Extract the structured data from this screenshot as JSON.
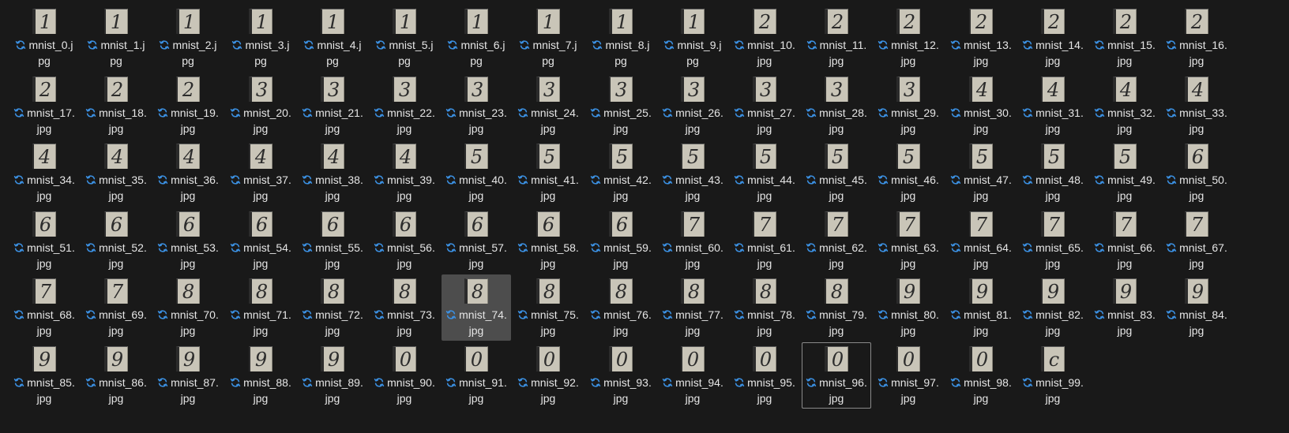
{
  "files": [
    {
      "line1": "mnist_0.j",
      "line2": "pg",
      "digit": "1"
    },
    {
      "line1": "mnist_1.j",
      "line2": "pg",
      "digit": "1"
    },
    {
      "line1": "mnist_2.j",
      "line2": "pg",
      "digit": "1"
    },
    {
      "line1": "mnist_3.j",
      "line2": "pg",
      "digit": "1"
    },
    {
      "line1": "mnist_4.j",
      "line2": "pg",
      "digit": "1"
    },
    {
      "line1": "mnist_5.j",
      "line2": "pg",
      "digit": "1"
    },
    {
      "line1": "mnist_6.j",
      "line2": "pg",
      "digit": "1"
    },
    {
      "line1": "mnist_7.j",
      "line2": "pg",
      "digit": "1"
    },
    {
      "line1": "mnist_8.j",
      "line2": "pg",
      "digit": "1"
    },
    {
      "line1": "mnist_9.j",
      "line2": "pg",
      "digit": "1"
    },
    {
      "line1": "mnist_10.",
      "line2": "jpg",
      "digit": "2"
    },
    {
      "line1": "mnist_11.",
      "line2": "jpg",
      "digit": "2"
    },
    {
      "line1": "mnist_12.",
      "line2": "jpg",
      "digit": "2"
    },
    {
      "line1": "mnist_13.",
      "line2": "jpg",
      "digit": "2"
    },
    {
      "line1": "mnist_14.",
      "line2": "jpg",
      "digit": "2"
    },
    {
      "line1": "mnist_15.",
      "line2": "jpg",
      "digit": "2"
    },
    {
      "line1": "mnist_16.",
      "line2": "jpg",
      "digit": "2"
    },
    {
      "line1": "mnist_17.",
      "line2": "jpg",
      "digit": "2"
    },
    {
      "line1": "mnist_18.",
      "line2": "jpg",
      "digit": "2"
    },
    {
      "line1": "mnist_19.",
      "line2": "jpg",
      "digit": "2"
    },
    {
      "line1": "mnist_20.",
      "line2": "jpg",
      "digit": "3"
    },
    {
      "line1": "mnist_21.",
      "line2": "jpg",
      "digit": "3"
    },
    {
      "line1": "mnist_22.",
      "line2": "jpg",
      "digit": "3"
    },
    {
      "line1": "mnist_23.",
      "line2": "jpg",
      "digit": "3"
    },
    {
      "line1": "mnist_24.",
      "line2": "jpg",
      "digit": "3"
    },
    {
      "line1": "mnist_25.",
      "line2": "jpg",
      "digit": "3"
    },
    {
      "line1": "mnist_26.",
      "line2": "jpg",
      "digit": "3"
    },
    {
      "line1": "mnist_27.",
      "line2": "jpg",
      "digit": "3"
    },
    {
      "line1": "mnist_28.",
      "line2": "jpg",
      "digit": "3"
    },
    {
      "line1": "mnist_29.",
      "line2": "jpg",
      "digit": "3"
    },
    {
      "line1": "mnist_30.",
      "line2": "jpg",
      "digit": "4"
    },
    {
      "line1": "mnist_31.",
      "line2": "jpg",
      "digit": "4"
    },
    {
      "line1": "mnist_32.",
      "line2": "jpg",
      "digit": "4"
    },
    {
      "line1": "mnist_33.",
      "line2": "jpg",
      "digit": "4"
    },
    {
      "line1": "mnist_34.",
      "line2": "jpg",
      "digit": "4"
    },
    {
      "line1": "mnist_35.",
      "line2": "jpg",
      "digit": "4"
    },
    {
      "line1": "mnist_36.",
      "line2": "jpg",
      "digit": "4"
    },
    {
      "line1": "mnist_37.",
      "line2": "jpg",
      "digit": "4"
    },
    {
      "line1": "mnist_38.",
      "line2": "jpg",
      "digit": "4"
    },
    {
      "line1": "mnist_39.",
      "line2": "jpg",
      "digit": "4"
    },
    {
      "line1": "mnist_40.",
      "line2": "jpg",
      "digit": "5"
    },
    {
      "line1": "mnist_41.",
      "line2": "jpg",
      "digit": "5"
    },
    {
      "line1": "mnist_42.",
      "line2": "jpg",
      "digit": "5"
    },
    {
      "line1": "mnist_43.",
      "line2": "jpg",
      "digit": "5"
    },
    {
      "line1": "mnist_44.",
      "line2": "jpg",
      "digit": "5"
    },
    {
      "line1": "mnist_45.",
      "line2": "jpg",
      "digit": "5"
    },
    {
      "line1": "mnist_46.",
      "line2": "jpg",
      "digit": "5"
    },
    {
      "line1": "mnist_47.",
      "line2": "jpg",
      "digit": "5"
    },
    {
      "line1": "mnist_48.",
      "line2": "jpg",
      "digit": "5"
    },
    {
      "line1": "mnist_49.",
      "line2": "jpg",
      "digit": "5"
    },
    {
      "line1": "mnist_50.",
      "line2": "jpg",
      "digit": "6"
    },
    {
      "line1": "mnist_51.",
      "line2": "jpg",
      "digit": "6"
    },
    {
      "line1": "mnist_52.",
      "line2": "jpg",
      "digit": "6"
    },
    {
      "line1": "mnist_53.",
      "line2": "jpg",
      "digit": "6"
    },
    {
      "line1": "mnist_54.",
      "line2": "jpg",
      "digit": "6"
    },
    {
      "line1": "mnist_55.",
      "line2": "jpg",
      "digit": "6"
    },
    {
      "line1": "mnist_56.",
      "line2": "jpg",
      "digit": "6"
    },
    {
      "line1": "mnist_57.",
      "line2": "jpg",
      "digit": "6"
    },
    {
      "line1": "mnist_58.",
      "line2": "jpg",
      "digit": "6"
    },
    {
      "line1": "mnist_59.",
      "line2": "jpg",
      "digit": "6"
    },
    {
      "line1": "mnist_60.",
      "line2": "jpg",
      "digit": "7"
    },
    {
      "line1": "mnist_61.",
      "line2": "jpg",
      "digit": "7"
    },
    {
      "line1": "mnist_62.",
      "line2": "jpg",
      "digit": "7"
    },
    {
      "line1": "mnist_63.",
      "line2": "jpg",
      "digit": "7"
    },
    {
      "line1": "mnist_64.",
      "line2": "jpg",
      "digit": "7"
    },
    {
      "line1": "mnist_65.",
      "line2": "jpg",
      "digit": "7"
    },
    {
      "line1": "mnist_66.",
      "line2": "jpg",
      "digit": "7"
    },
    {
      "line1": "mnist_67.",
      "line2": "jpg",
      "digit": "7"
    },
    {
      "line1": "mnist_68.",
      "line2": "jpg",
      "digit": "7"
    },
    {
      "line1": "mnist_69.",
      "line2": "jpg",
      "digit": "7"
    },
    {
      "line1": "mnist_70.",
      "line2": "jpg",
      "digit": "8"
    },
    {
      "line1": "mnist_71.",
      "line2": "jpg",
      "digit": "8"
    },
    {
      "line1": "mnist_72.",
      "line2": "jpg",
      "digit": "8"
    },
    {
      "line1": "mnist_73.",
      "line2": "jpg",
      "digit": "8"
    },
    {
      "line1": "mnist_74.",
      "line2": "jpg",
      "digit": "8"
    },
    {
      "line1": "mnist_75.",
      "line2": "jpg",
      "digit": "8"
    },
    {
      "line1": "mnist_76.",
      "line2": "jpg",
      "digit": "8"
    },
    {
      "line1": "mnist_77.",
      "line2": "jpg",
      "digit": "8"
    },
    {
      "line1": "mnist_78.",
      "line2": "jpg",
      "digit": "8"
    },
    {
      "line1": "mnist_79.",
      "line2": "jpg",
      "digit": "8"
    },
    {
      "line1": "mnist_80.",
      "line2": "jpg",
      "digit": "9"
    },
    {
      "line1": "mnist_81.",
      "line2": "jpg",
      "digit": "9"
    },
    {
      "line1": "mnist_82.",
      "line2": "jpg",
      "digit": "9"
    },
    {
      "line1": "mnist_83.",
      "line2": "jpg",
      "digit": "9"
    },
    {
      "line1": "mnist_84.",
      "line2": "jpg",
      "digit": "9"
    },
    {
      "line1": "mnist_85.",
      "line2": "jpg",
      "digit": "9"
    },
    {
      "line1": "mnist_86.",
      "line2": "jpg",
      "digit": "9"
    },
    {
      "line1": "mnist_87.",
      "line2": "jpg",
      "digit": "9"
    },
    {
      "line1": "mnist_88.",
      "line2": "jpg",
      "digit": "9"
    },
    {
      "line1": "mnist_89.",
      "line2": "jpg",
      "digit": "9"
    },
    {
      "line1": "mnist_90.",
      "line2": "jpg",
      "digit": "0"
    },
    {
      "line1": "mnist_91.",
      "line2": "jpg",
      "digit": "0"
    },
    {
      "line1": "mnist_92.",
      "line2": "jpg",
      "digit": "0"
    },
    {
      "line1": "mnist_93.",
      "line2": "jpg",
      "digit": "0"
    },
    {
      "line1": "mnist_94.",
      "line2": "jpg",
      "digit": "0"
    },
    {
      "line1": "mnist_95.",
      "line2": "jpg",
      "digit": "0"
    },
    {
      "line1": "mnist_96.",
      "line2": "jpg",
      "digit": "0"
    },
    {
      "line1": "mnist_97.",
      "line2": "jpg",
      "digit": "0"
    },
    {
      "line1": "mnist_98.",
      "line2": "jpg",
      "digit": "0"
    },
    {
      "line1": "mnist_99.",
      "line2": "jpg",
      "digit": "c"
    }
  ],
  "selected_file": "mnist_74.jpg",
  "focused_file": "mnist_96.jpg",
  "status_icon": "sync-icon",
  "colors": {
    "background": "#191919",
    "selection": "#4d4d4d",
    "focus_border": "#8a8a8a",
    "sync_icon": "#3b8fe0",
    "text": "#e6e6e6"
  }
}
